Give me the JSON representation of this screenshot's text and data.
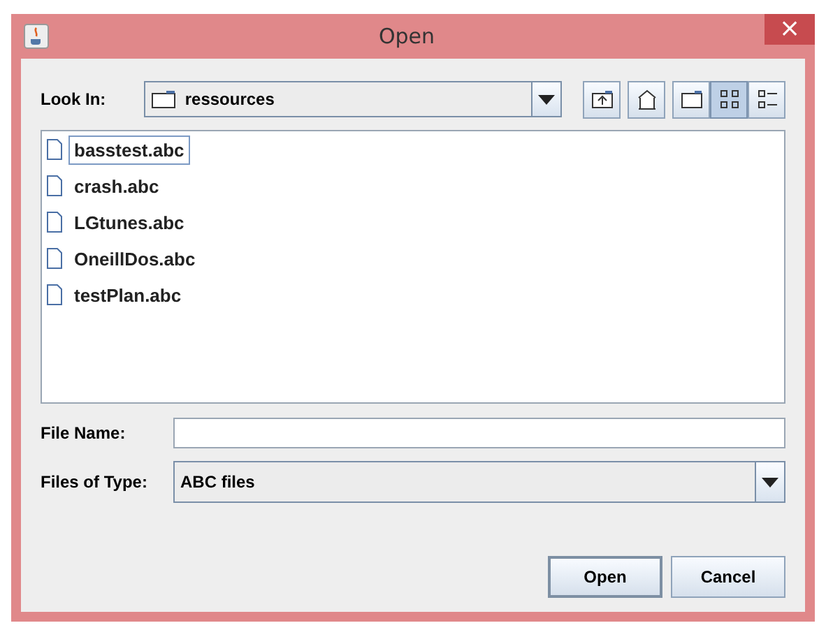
{
  "window": {
    "title": "Open",
    "close": "×"
  },
  "look_in": {
    "label": "Look In:",
    "value": "ressources"
  },
  "toolbar": [
    {
      "kind": "up",
      "selected": false
    },
    {
      "kind": "home",
      "selected": false
    },
    {
      "kind": "new-folder",
      "selected": false
    },
    {
      "kind": "list",
      "selected": true
    },
    {
      "kind": "details",
      "selected": false
    }
  ],
  "files": [
    {
      "name": "basstest.abc",
      "selected": true
    },
    {
      "name": "crash.abc",
      "selected": false
    },
    {
      "name": "LGtunes.abc",
      "selected": false
    },
    {
      "name": "OneillDos.abc",
      "selected": false
    },
    {
      "name": "testPlan.abc",
      "selected": false
    }
  ],
  "file_name": {
    "label": "File Name:"
  },
  "file_type": {
    "label": "Files of Type:",
    "value": "ABC files"
  },
  "buttons": [
    "Open",
    "Cancel"
  ]
}
